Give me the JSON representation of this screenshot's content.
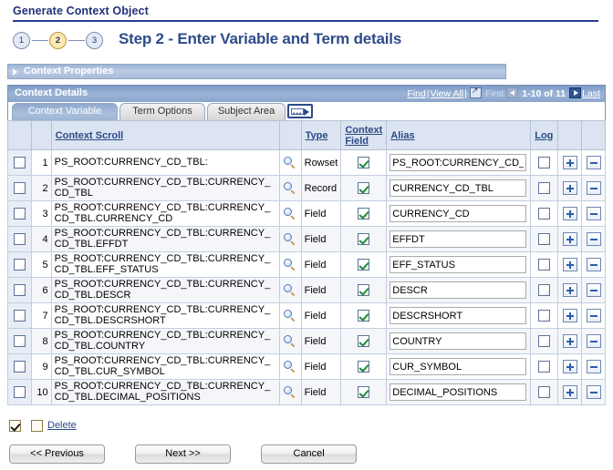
{
  "page": {
    "title": "Generate Context Object",
    "step_heading": "Step 2 - Enter Variable and Term details",
    "steps": [
      {
        "number": "1",
        "active": false
      },
      {
        "number": "2",
        "active": true
      },
      {
        "number": "3",
        "active": false
      }
    ]
  },
  "context_properties": {
    "label": "Context Properties",
    "expanded": false
  },
  "context_details": {
    "title": "Context Details",
    "nav": {
      "find": "Find",
      "separator": "|",
      "view_all": "View All",
      "download_icon": "download-to-excel-icon",
      "first": "First",
      "prev_icon": "previous-page-icon",
      "range": "1-10 of 11",
      "next_icon": "next-page-icon",
      "last": "Last"
    },
    "tabs": [
      {
        "label": "Context Variable",
        "active": true
      },
      {
        "label": "Term Options",
        "active": false
      },
      {
        "label": "Subject Area",
        "active": false
      }
    ],
    "customize_icon": "show-all-columns-icon",
    "columns": {
      "select": "",
      "number": "",
      "context_scroll": "Context Scroll",
      "lookup": "",
      "type": "Type",
      "context_field": "Context Field",
      "alias": "Alias",
      "log": "Log",
      "add": "",
      "remove": ""
    },
    "rows": [
      {
        "num": "1",
        "selected": false,
        "context_scroll": "PS_ROOT:CURRENCY_CD_TBL:",
        "lookup_icon": "magnifier-icon",
        "type": "Rowset",
        "context_field": true,
        "alias": "PS_ROOT:CURRENCY_CD_TBL:",
        "log": false,
        "add_label": "+",
        "remove_label": "-"
      },
      {
        "num": "2",
        "selected": false,
        "context_scroll": "PS_ROOT:CURRENCY_CD_TBL:CURRENCY_CD_TBL",
        "lookup_icon": "magnifier-icon",
        "type": "Record",
        "context_field": true,
        "alias": "CURRENCY_CD_TBL",
        "log": false,
        "add_label": "+",
        "remove_label": "-"
      },
      {
        "num": "3",
        "selected": false,
        "context_scroll": "PS_ROOT:CURRENCY_CD_TBL:CURRENCY_CD_TBL.CURRENCY_CD",
        "lookup_icon": "magnifier-icon",
        "type": "Field",
        "context_field": true,
        "alias": "CURRENCY_CD",
        "log": false,
        "add_label": "+",
        "remove_label": "-"
      },
      {
        "num": "4",
        "selected": false,
        "context_scroll": "PS_ROOT:CURRENCY_CD_TBL:CURRENCY_CD_TBL.EFFDT",
        "lookup_icon": "magnifier-icon",
        "type": "Field",
        "context_field": true,
        "alias": "EFFDT",
        "log": false,
        "add_label": "+",
        "remove_label": "-"
      },
      {
        "num": "5",
        "selected": false,
        "context_scroll": "PS_ROOT:CURRENCY_CD_TBL:CURRENCY_CD_TBL.EFF_STATUS",
        "lookup_icon": "magnifier-icon",
        "type": "Field",
        "context_field": true,
        "alias": "EFF_STATUS",
        "log": false,
        "add_label": "+",
        "remove_label": "-"
      },
      {
        "num": "6",
        "selected": false,
        "context_scroll": "PS_ROOT:CURRENCY_CD_TBL:CURRENCY_CD_TBL.DESCR",
        "lookup_icon": "magnifier-icon",
        "type": "Field",
        "context_field": true,
        "alias": "DESCR",
        "log": false,
        "add_label": "+",
        "remove_label": "-"
      },
      {
        "num": "7",
        "selected": false,
        "context_scroll": "PS_ROOT:CURRENCY_CD_TBL:CURRENCY_CD_TBL.DESCRSHORT",
        "lookup_icon": "magnifier-icon",
        "type": "Field",
        "context_field": true,
        "alias": "DESCRSHORT",
        "log": false,
        "add_label": "+",
        "remove_label": "-"
      },
      {
        "num": "8",
        "selected": false,
        "context_scroll": "PS_ROOT:CURRENCY_CD_TBL:CURRENCY_CD_TBL.COUNTRY",
        "lookup_icon": "magnifier-icon",
        "type": "Field",
        "context_field": true,
        "alias": "COUNTRY",
        "log": false,
        "add_label": "+",
        "remove_label": "-"
      },
      {
        "num": "9",
        "selected": false,
        "context_scroll": "PS_ROOT:CURRENCY_CD_TBL:CURRENCY_CD_TBL.CUR_SYMBOL",
        "lookup_icon": "magnifier-icon",
        "type": "Field",
        "context_field": true,
        "alias": "CUR_SYMBOL",
        "log": false,
        "add_label": "+",
        "remove_label": "-"
      },
      {
        "num": "10",
        "selected": false,
        "context_scroll": "PS_ROOT:CURRENCY_CD_TBL:CURRENCY_CD_TBL.DECIMAL_POSITIONS",
        "lookup_icon": "magnifier-icon",
        "type": "Field",
        "context_field": true,
        "alias": "DECIMAL_POSITIONS",
        "log": false,
        "add_label": "+",
        "remove_label": "-"
      }
    ]
  },
  "footer": {
    "select_all_checked": true,
    "deselect_all_checked": false,
    "delete_label": "Delete",
    "buttons": [
      {
        "label": "<< Previous",
        "name": "previous-button"
      },
      {
        "label": "Next >>",
        "name": "next-button"
      },
      {
        "label": "Cancel",
        "name": "cancel-button"
      }
    ]
  },
  "colors": {
    "title_blue": "#21317a",
    "heading_blue": "#2e4c89",
    "link_blue": "#2b4a85",
    "header_bar": "#8aa5cd",
    "active_step": "#fde8ae",
    "check_green": "#1f8a37"
  }
}
